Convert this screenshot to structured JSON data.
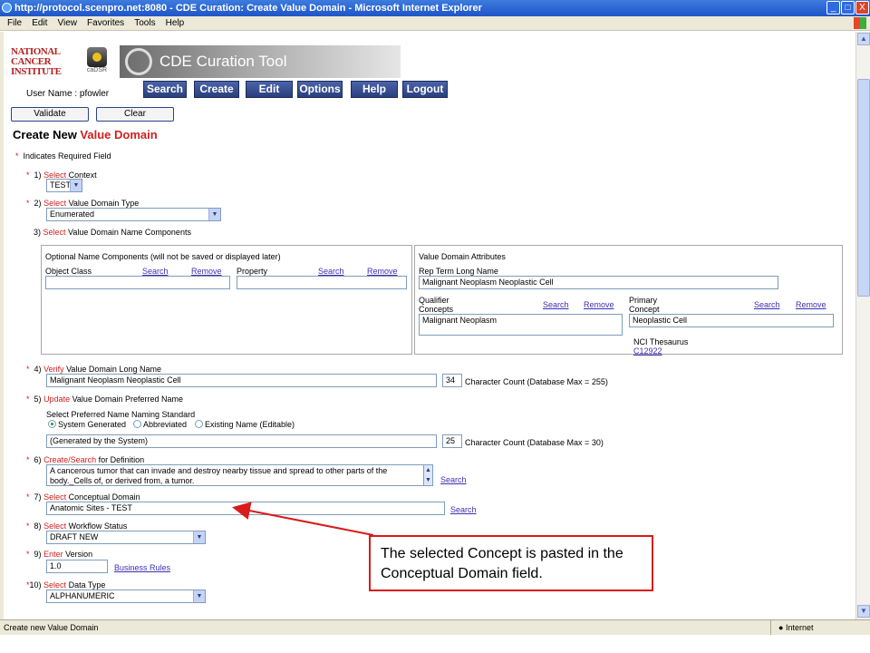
{
  "window": {
    "title": "http://protocol.scenpro.net:8080 - CDE Curation: Create Value Domain - Microsoft Internet Explorer",
    "min": "_",
    "max": "□",
    "close": "X"
  },
  "menu": [
    "File",
    "Edit",
    "View",
    "Favorites",
    "Tools",
    "Help"
  ],
  "logo": {
    "nci_lines": [
      "NATIONAL",
      "CANCER",
      "INSTITUTE"
    ],
    "cadsr": "caDSR"
  },
  "app_title": "CDE Curation Tool",
  "user": "User Name : pfowler",
  "nav": [
    "Search",
    "Create",
    "Edit",
    "Options",
    "Help",
    "Logout"
  ],
  "actions": {
    "validate": "Validate",
    "clear": "Clear"
  },
  "heading": {
    "prefix": "Create New ",
    "highlight": "Value Domain"
  },
  "required_note": "Indicates Required Field",
  "steps": {
    "s1": {
      "num": "1)",
      "action": "Select",
      "label": " Context",
      "value": "TEST"
    },
    "s2": {
      "num": "2)",
      "action": "Select",
      "label": " Value Domain Type",
      "value": "Enumerated"
    },
    "s3": {
      "num": "3)",
      "action": "Select",
      "label": " Value Domain Name Components"
    },
    "s4": {
      "num": "4)",
      "action": "Verify",
      "label": " Value Domain Long Name",
      "value": "Malignant Neoplasm Neoplastic Cell",
      "count": "34",
      "count_label": "Character Count  (Database Max = 255)"
    },
    "s5": {
      "num": "5)",
      "action": "Update",
      "label": " Value Domain Preferred Name",
      "std_label": "Select Preferred Name Naming Standard",
      "opt1": "System Generated",
      "opt2": "Abbreviated",
      "opt3": "Existing Name (Editable)",
      "value": "(Generated by the System)",
      "count": "25",
      "count_label": "Character Count  (Database Max = 30)"
    },
    "s6": {
      "num": "6)",
      "action": "Create/Search",
      "label": " for Definition",
      "value": "A cancerous tumor that can invade and destroy nearby tissue and spread to other parts of the body._Cells of, or derived from, a tumor.",
      "search": "Search"
    },
    "s7": {
      "num": "7)",
      "action": "Select",
      "label": " Conceptual Domain",
      "value": "Anatomic Sites - TEST",
      "search": "Search"
    },
    "s8": {
      "num": "8)",
      "action": "Select",
      "label": " Workflow Status",
      "value": "DRAFT NEW"
    },
    "s9": {
      "num": "9)",
      "action": "Enter",
      "label": " Version",
      "value": "1.0",
      "link": "Business Rules"
    },
    "s10": {
      "num": "10)",
      "action": "Select",
      "label": " Data Type",
      "value": "ALPHANUMERIC"
    }
  },
  "optional": {
    "title": "Optional Name Components (will not be saved or displayed later)",
    "object_class": "Object Class",
    "property": "Property",
    "search": "Search",
    "remove": "Remove"
  },
  "vd_attrs": {
    "title": "Value Domain Attributes",
    "rep_term_label": "Rep Term Long Name",
    "rep_term_value": "Malignant Neoplasm Neoplastic Cell",
    "qualifier_label": "Qualifier\nConcepts",
    "qualifier_value": "Malignant Neoplasm",
    "primary_label": "Primary\nConcept",
    "primary_value": "Neoplastic Cell",
    "nci": "NCI Thesaurus",
    "code": "C12922",
    "search": "Search",
    "remove": "Remove"
  },
  "annotation": "The selected Concept is pasted in the Conceptual Domain field.",
  "status": {
    "left": "Create new Value Domain",
    "zone": "Internet"
  }
}
